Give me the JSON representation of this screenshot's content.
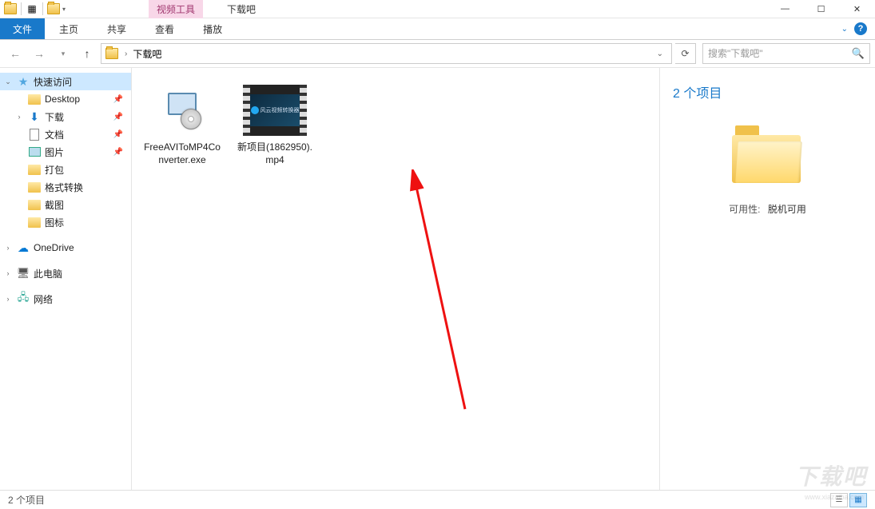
{
  "titlebar": {
    "context_tab": "视频工具",
    "title": "下载吧",
    "minimize": "—",
    "maximize": "☐",
    "close": "✕"
  },
  "ribbon": {
    "file": "文件",
    "tabs": [
      "主页",
      "共享",
      "查看",
      "播放"
    ]
  },
  "address": {
    "folder": "下载吧",
    "search_placeholder": "搜索\"下载吧\""
  },
  "sidebar": {
    "quick_access": "快速访问",
    "items": [
      {
        "label": "Desktop",
        "pinned": true
      },
      {
        "label": "下载",
        "pinned": true
      },
      {
        "label": "文档",
        "pinned": true
      },
      {
        "label": "图片",
        "pinned": true
      },
      {
        "label": "打包",
        "pinned": false
      },
      {
        "label": "格式转换",
        "pinned": false
      },
      {
        "label": "截图",
        "pinned": false
      },
      {
        "label": "图标",
        "pinned": false
      }
    ],
    "onedrive": "OneDrive",
    "this_pc": "此电脑",
    "network": "网络"
  },
  "files": [
    {
      "name": "FreeAVIToMP4Converter.exe",
      "type": "exe"
    },
    {
      "name": "新项目(1862950).mp4",
      "type": "video",
      "thumb_text": "风云视频转换器"
    }
  ],
  "details": {
    "title": "2 个项目",
    "availability_label": "可用性:",
    "availability_value": "脱机可用"
  },
  "statusbar": {
    "count": "2 个项目"
  },
  "watermark": {
    "main": "下载吧",
    "sub": "www.xiazaiba.com"
  }
}
